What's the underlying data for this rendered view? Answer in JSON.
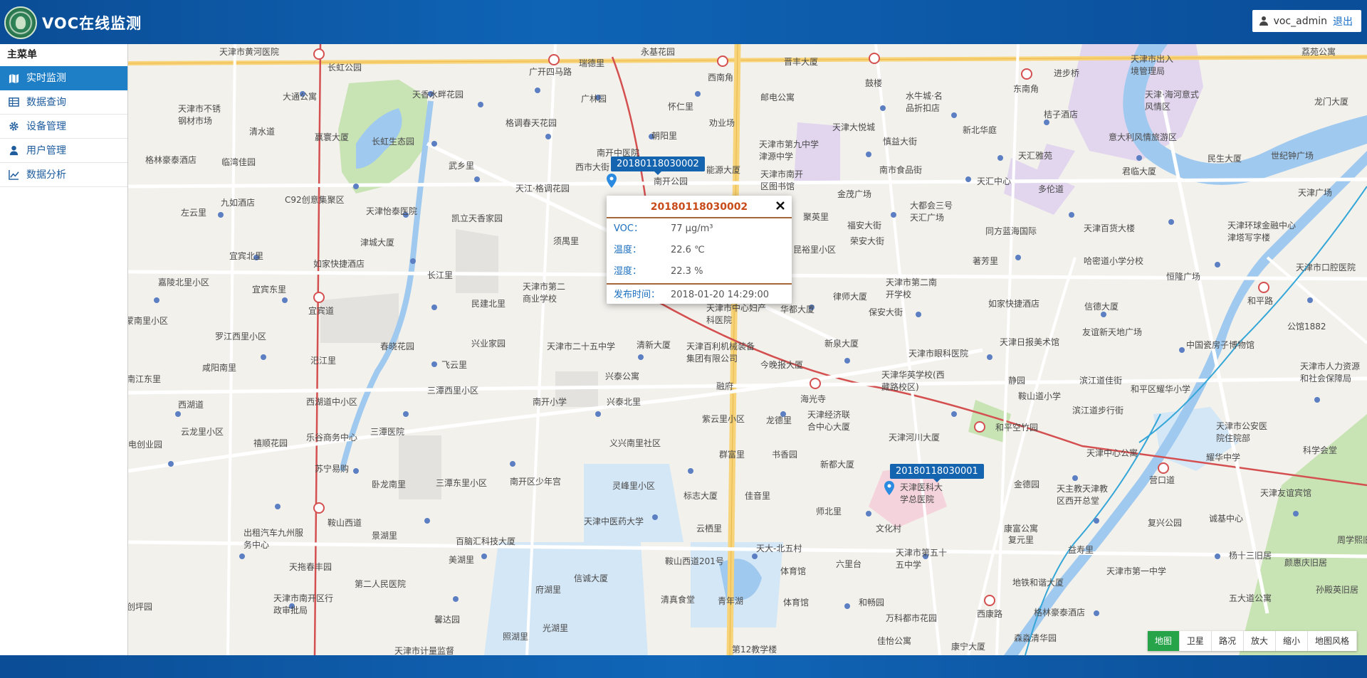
{
  "header": {
    "app_title": "VOC在线监测",
    "username": "voc_admin",
    "logout_label": "退出"
  },
  "sidebar": {
    "title": "主菜单",
    "items": [
      {
        "label": "实时监测",
        "icon": "map-icon",
        "active": true
      },
      {
        "label": "数据查询",
        "icon": "table-icon",
        "active": false
      },
      {
        "label": "设备管理",
        "icon": "gear-icon",
        "active": false
      },
      {
        "label": "用户管理",
        "icon": "user-icon",
        "active": false
      },
      {
        "label": "数据分析",
        "icon": "chart-icon",
        "active": false
      }
    ]
  },
  "map": {
    "markers": [
      {
        "id": "2018011803 0002",
        "label": "20180118030002"
      },
      {
        "id": "20180118030001",
        "label": "20180118030001"
      }
    ],
    "popup": {
      "title": "20180118030002",
      "rows": [
        {
          "key": "VOC：",
          "value": "77 μg/m³"
        },
        {
          "key": "温度：",
          "value": "22.6 ℃"
        },
        {
          "key": "湿度：",
          "value": "22.3 %"
        }
      ],
      "time_key": "发布时间：",
      "time_value": "2018-01-20 14:29:00"
    },
    "labels": {
      "l1": "天津市黄河医院",
      "l2": "长虹公园",
      "l3": "广开四马路",
      "l4": "瑞德里",
      "l5": "永基花园",
      "l6": "西南角",
      "l7": "晋丰大厦",
      "l8": "鼓楼",
      "l9": "水牛城·名品折扣店",
      "l10": "东南角",
      "l11": "进步桥",
      "l12": "天津市出入境管理局",
      "l13": "荔苑公寓",
      "l14": "大通公寓",
      "l15": "天香水畔花园",
      "l16": "广林园",
      "l17": "怀仁里",
      "l18": "邮电公寓",
      "l19": "天津大悦城",
      "l20": "新北华庭",
      "l21": "桔子酒店",
      "l22": "天津·海河意式风情区",
      "l23": "龙门大厦",
      "l24": "天津市不锈钢材市场",
      "l25": "清水道",
      "l26": "赢寰大厦",
      "l27": "长虹生态园",
      "l28": "格调春天花园",
      "l29": "朝阳里",
      "l30": "劝业场",
      "l31": "天津市第九中学津源中学",
      "l32": "慎益大街",
      "l33": "南市食品街",
      "l34": "天汇雅苑",
      "l35": "意大利风情旅游区",
      "l36": "民生大厦",
      "l37": "世纪钟广场",
      "l38": "格林豪泰酒店",
      "l39": "临湾佳园",
      "l40": "武乡里",
      "l41": "南开中医院",
      "l42": "西市大街",
      "l43": "能源大厦",
      "l44": "天津市南开区图书馆",
      "l45": "君临大厦",
      "l46": "天汇中心",
      "l47": "多伦道",
      "l48": "天津广场",
      "l49": "九如酒店",
      "l50": "C92创意集聚区",
      "l51": "天江·格调花园",
      "l52": "南开公园",
      "l53": "金茂广场",
      "l54": "大都会三号天汇广场",
      "l55": "左云里",
      "l56": "天津怡泰医院",
      "l57": "凯立天香家园",
      "l58": "聚英里",
      "l59": "福安大街",
      "l60": "同方蓝海国际",
      "l61": "天津百货大楼",
      "l62": "天津环球金融中心津塔写字楼",
      "l63": "宜宾北里",
      "l64": "天津市口腔医院",
      "l65": "如家快捷酒店",
      "l66": "津城大厦",
      "l67": "须禺里",
      "l68": "昆裕里小区",
      "l69": "荣安大街",
      "l70": "著芳里",
      "l71": "哈密道小学分校",
      "l72": "恒隆广场",
      "l73": "嘉陵北里小区",
      "l74": "长江里",
      "l75": "天津市第二商业学校",
      "l76": "天津市第二南开学校",
      "l77": "如家快捷酒店",
      "l78": "信德大厦",
      "l79": "和平路",
      "l80": "宜宾东里",
      "l81": "民建北里",
      "l82": "天津市中心妇产科医院",
      "l83": "华都大厦",
      "l84": "律师大厦",
      "l85": "保安大街",
      "l86": "蒙南里小区",
      "l87": "罗江西里小区",
      "l88": "宜宾道",
      "l89": "春晓花园",
      "l90": "兴业家园",
      "l91": "天津市二十五中学",
      "l92": "清新大厦",
      "l93": "天津百利机械装备集团有限公司",
      "l94": "新泉大厦",
      "l95": "天津市眼科医院",
      "l96": "天津日报美术馆",
      "l97": "友谊新天地广场",
      "l98": "中国瓷房子博物馆",
      "l99": "公馆1882",
      "l100": "咸阳南里",
      "l101": "汜江里",
      "l102": "飞云里",
      "l103": "今晚报大厦",
      "l104": "静园",
      "l105": "天津华英学校(西藏路校区)",
      "l106": "天津市人力资源和社会保障局",
      "l107": "南江东里",
      "l108": "三潭西里小区",
      "l109": "兴泰公寓",
      "l110": "融府",
      "l111": "海光寺",
      "l112": "滨江道佳街",
      "l113": "鞍山道小学",
      "l114": "和平区耀华小学",
      "l115": "西湖道",
      "l116": "西湖道中小区",
      "l117": "南开小学",
      "l118": "兴泰北里",
      "l119": "紫云里小区",
      "l120": "龙德里",
      "l121": "天津经济联合中心大厦",
      "l122": "滨江道步行街",
      "l123": "云龙里小区",
      "l124": "乐谷商务中心",
      "l125": "义兴南里社区",
      "l126": "天津河川大厦",
      "l127": "和平空竹园",
      "l128": "天津市公安医院住院部",
      "l129": "科学会堂",
      "l130": "电创业园",
      "l131": "禧顺花园",
      "l132": "三潭医院",
      "l133": "书香园",
      "l134": "群富里",
      "l135": "天津中心公寓",
      "l136": "营口道",
      "l137": "耀华中学",
      "l138": "苏宁易购",
      "l139": "卧龙南里",
      "l140": "三潭东里小区",
      "l141": "南开区少年宫",
      "l142": "灵峰里小区",
      "l143": "标志大厦",
      "l144": "佳音里",
      "l145": "新都大厦",
      "l146": "天津医科大学总医院",
      "l147": "金德园",
      "l148": "天主教天津教区西开总堂",
      "l149": "复兴公园",
      "l150": "天津友谊宾馆",
      "l151": "鞍山西道",
      "l152": "景湖里",
      "l153": "天津中医药大学",
      "l154": "师北里",
      "l155": "文化村",
      "l156": "康富公寓",
      "l157": "诚基中心",
      "l158": "出租汽车九州服务中心",
      "l159": "百脑汇科技大厦",
      "l160": "云栖里",
      "l161": "天大-北五村",
      "l162": "复元里",
      "l163": "益寿里",
      "l164": "杨十三旧居",
      "l165": "颜惠庆旧居",
      "l166": "周学熙旧",
      "l167": "天拖春丰园",
      "l168": "美湖里",
      "l169": "鞍山西道201号",
      "l170": "体育馆",
      "l171": "六里台",
      "l172": "天津市第五十五中学",
      "l173": "天津市第一中学",
      "l174": "孙殿英旧居",
      "l175": "第二人民医院",
      "l176": "府湖里",
      "l177": "信诚大厦",
      "l178": "清真食堂",
      "l179": "青年湖",
      "l180": "体育馆",
      "l181": "和畅园",
      "l182": "地铁和谐大厦",
      "l183": "五大道公寓",
      "l184": "天津市南开区行政审批局",
      "l185": "创坪园",
      "l186": "馨达园",
      "l187": "光湖里",
      "l188": "万科都市花园",
      "l189": "西康路",
      "l190": "格林豪泰酒店",
      "l191": "照湖里",
      "l192": "佳怡公寓",
      "l193": "天津市计量监督",
      "l194": "第12教学楼",
      "l195": "康宁大厦",
      "l196": "森淼清华园"
    },
    "controls": [
      "地图",
      "卫星",
      "路况",
      "放大",
      "缩小",
      "地图风格"
    ]
  }
}
